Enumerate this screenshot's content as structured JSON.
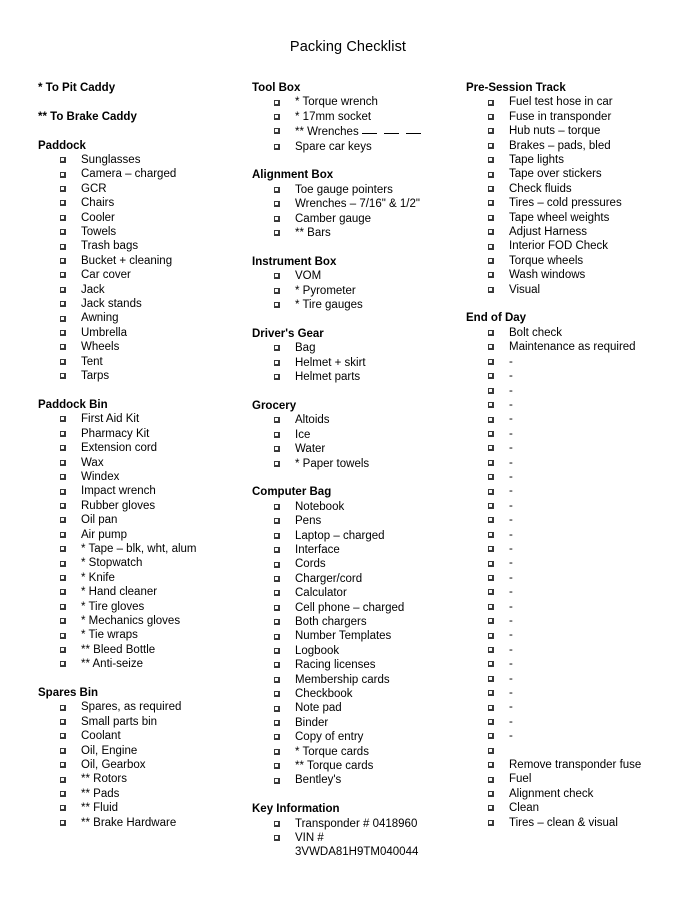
{
  "document": {
    "title": "Packing Checklist"
  },
  "legend": [
    "* To Pit Caddy",
    "** To Brake Caddy"
  ],
  "columns": [
    {
      "name": "column-left",
      "sections": [
        {
          "title": "Paddock",
          "items": [
            "Sunglasses",
            "Camera – charged",
            "GCR",
            "Chairs",
            "Cooler",
            "Towels",
            "Trash bags",
            "Bucket + cleaning",
            "Car cover",
            "Jack",
            "Jack stands",
            "Awning",
            "Umbrella",
            "Wheels",
            "Tent",
            "Tarps"
          ]
        },
        {
          "title": "Paddock Bin",
          "items": [
            "First Aid Kit",
            "Pharmacy Kit",
            "Extension cord",
            "Wax",
            "Windex",
            "Impact wrench",
            "Rubber gloves",
            "Oil pan",
            "Air pump",
            "* Tape – blk, wht, alum",
            "* Stopwatch",
            "* Knife",
            "* Hand cleaner",
            "* Tire gloves",
            "* Mechanics gloves",
            "* Tie wraps",
            "** Bleed Bottle",
            "** Anti-seize"
          ]
        },
        {
          "title": "Spares Bin",
          "items": [
            "Spares, as required",
            "Small parts bin",
            "Coolant",
            "Oil, Engine",
            "Oil, Gearbox",
            "** Rotors",
            "** Pads",
            "** Fluid",
            "** Brake Hardware"
          ]
        }
      ]
    },
    {
      "name": "column-middle",
      "sections": [
        {
          "title": "Tool Box",
          "items": [
            "* Torque wrench",
            "* 17mm socket",
            {
              "label": "** Wrenches",
              "blanks": 3
            },
            "Spare car keys"
          ]
        },
        {
          "title": "Alignment Box",
          "items": [
            "Toe gauge pointers",
            "Wrenches – 7/16\" & 1/2\"",
            "Camber gauge",
            "** Bars"
          ]
        },
        {
          "title": "Instrument Box",
          "items": [
            "VOM",
            "* Pyrometer",
            "* Tire gauges"
          ]
        },
        {
          "title": "Driver's Gear",
          "items": [
            "Bag",
            "Helmet + skirt",
            "Helmet parts"
          ]
        },
        {
          "title": "Grocery",
          "items": [
            "Altoids",
            "Ice",
            "Water",
            "* Paper towels"
          ]
        },
        {
          "title": "Computer Bag",
          "items": [
            "Notebook",
            "Pens",
            "Laptop – charged",
            "Interface",
            "Cords",
            "Charger/cord",
            "Calculator",
            "Cell phone – charged",
            "Both chargers",
            "Number Templates",
            "Logbook",
            "Racing licenses",
            "Membership cards",
            "Checkbook",
            "Note pad",
            "Binder",
            "Copy of entry",
            "* Torque cards",
            "** Torque cards",
            "Bentley's"
          ]
        },
        {
          "title": "Key Information",
          "items": [
            "Transponder # 0418960",
            {
              "label": "VIN #",
              "continuation": "3VWDA81H9TM040044"
            }
          ]
        }
      ]
    },
    {
      "name": "column-right",
      "sections": [
        {
          "title": "Pre-Session Track",
          "items": [
            "Fuel test hose in car",
            "Fuse in transponder",
            "Hub nuts – torque",
            "Brakes – pads, bled",
            "Tape lights",
            "Tape over stickers",
            "Check fluids",
            "Tires – cold pressures",
            "Tape wheel weights",
            "Adjust Harness",
            "Interior FOD Check",
            "Torque wheels",
            "Wash windows",
            "Visual"
          ]
        },
        {
          "title": "End of Day",
          "items": [
            "Bolt check",
            "Maintenance as required",
            "-",
            "-",
            "-",
            "-",
            "-",
            "-",
            "-",
            "-",
            "-",
            "-",
            "-",
            "-",
            "-",
            "-",
            "-",
            "-",
            "-",
            "-",
            "-",
            "-",
            "-",
            "-",
            "-",
            "-",
            "-",
            "-",
            "-",
            "",
            "Remove transponder fuse",
            "Fuel",
            "Alignment check",
            "Clean",
            "Tires – clean & visual"
          ]
        }
      ]
    }
  ]
}
